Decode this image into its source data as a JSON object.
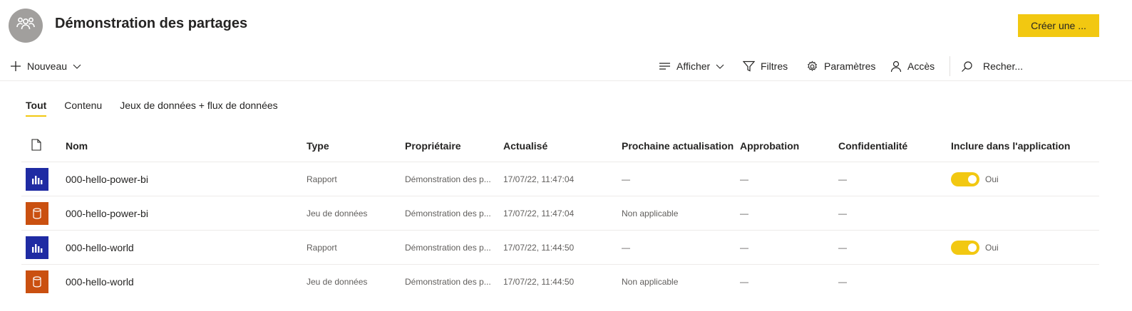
{
  "workspace": {
    "title": "Démonstration des partages",
    "create_label": "Créer une ...",
    "avatar_icon": "people-group-icon"
  },
  "commandbar": {
    "new_label": "Nouveau",
    "view_label": "Afficher",
    "filters_label": "Filtres",
    "settings_label": "Paramètres",
    "access_label": "Accès",
    "search_placeholder": "Recher..."
  },
  "tabs": [
    {
      "label": "Tout",
      "active": true
    },
    {
      "label": "Contenu",
      "active": false
    },
    {
      "label": "Jeux de données + flux de données",
      "active": false
    }
  ],
  "table": {
    "columns": {
      "icon": "file-icon",
      "name": "Nom",
      "type": "Type",
      "owner": "Propriétaire",
      "updated": "Actualisé",
      "next": "Prochaine actualisation",
      "approval": "Approbation",
      "sensitivity": "Confidentialité",
      "include": "Inclure dans l'application"
    },
    "rows": [
      {
        "kind": "report",
        "icon": "report-chart-icon",
        "name": "000-hello-power-bi",
        "type": "Rapport",
        "owner": "Démonstration des p...",
        "updated": "17/07/22, 11:47:04",
        "next": "—",
        "approval": "—",
        "sensitivity": "—",
        "include": "Oui",
        "include_on": true
      },
      {
        "kind": "dataset",
        "icon": "dataset-cylinder-icon",
        "name": "000-hello-power-bi",
        "type": "Jeu de données",
        "owner": "Démonstration des p...",
        "updated": "17/07/22, 11:47:04",
        "next": "Non applicable",
        "approval": "—",
        "sensitivity": "—",
        "include": "",
        "include_on": false
      },
      {
        "kind": "report",
        "icon": "report-chart-icon",
        "name": "000-hello-world",
        "type": "Rapport",
        "owner": "Démonstration des p...",
        "updated": "17/07/22, 11:44:50",
        "next": "—",
        "approval": "—",
        "sensitivity": "—",
        "include": "Oui",
        "include_on": true
      },
      {
        "kind": "dataset",
        "icon": "dataset-cylinder-icon",
        "name": "000-hello-world",
        "type": "Jeu de données",
        "owner": "Démonstration des p...",
        "updated": "17/07/22, 11:44:50",
        "next": "Non applicable",
        "approval": "—",
        "sensitivity": "—",
        "include": "",
        "include_on": false
      }
    ]
  },
  "colors": {
    "accent": "#f2c811",
    "report_icon_bg": "#1f2ba3",
    "dataset_icon_bg": "#ca5010",
    "avatar_bg": "#a19f9d"
  }
}
